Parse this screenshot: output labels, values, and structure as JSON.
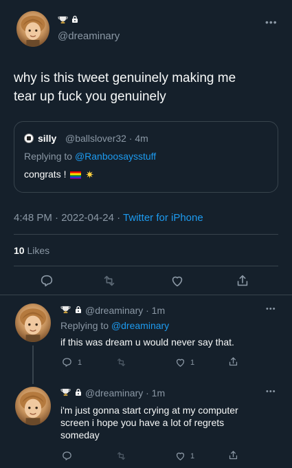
{
  "tweet": {
    "handle": "@dreaminary",
    "text_line1": "why is this tweet genuinely making me",
    "text_line2": "tear up fuck you genuinely",
    "quote": {
      "name": "silly",
      "handle_time": "@ballslover32 · 4m",
      "replying_prefix": "Replying to ",
      "replying_to": "@Ranboosaysstuff",
      "text": "congrats ! "
    },
    "time": "4:48 PM · 2022-04-24 · ",
    "source": "Twitter for iPhone",
    "likes_count": "10",
    "likes_label": "Likes"
  },
  "replies": [
    {
      "handle_time": "@dreaminary · 1m",
      "replying_prefix": "Replying to ",
      "replying_to": "@dreaminary",
      "text": "if this was dream u would never say that.",
      "reply_count": "1",
      "like_count": "1"
    },
    {
      "handle_time": "@dreaminary · 1m",
      "text_line1": "i'm just gonna start crying at my computer",
      "text_line2": "screen i hope you have a lot of regrets",
      "text_line3": "someday",
      "like_count": "1"
    }
  ],
  "icons": {
    "more": "more-icon",
    "reply": "reply-icon",
    "retweet": "retweet-icon",
    "like": "like-icon",
    "share": "share-icon",
    "lock": "lock-icon",
    "trophy": "trophy-icon"
  },
  "colors": {
    "background": "#15202b",
    "accent": "#1d9bf0",
    "secondary_text": "#8b98a5",
    "border": "#38444d"
  }
}
